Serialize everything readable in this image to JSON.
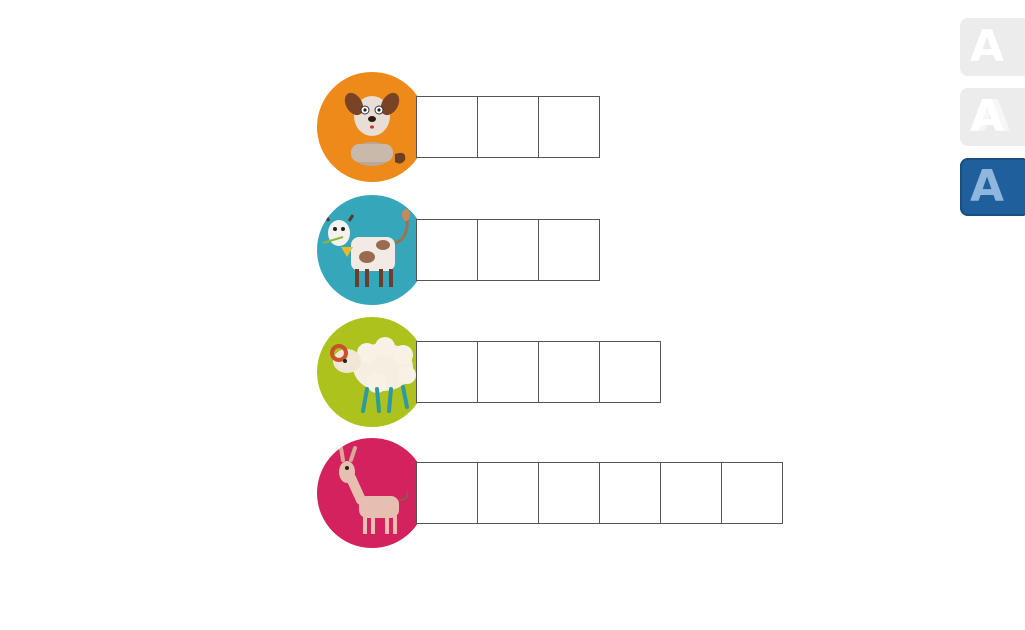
{
  "side_buttons": [
    {
      "letter": "A",
      "style": "plain"
    },
    {
      "letter": "A",
      "style": "outlined"
    },
    {
      "letter": "A",
      "style": "textured",
      "color": "#1f5f9b"
    }
  ],
  "rows": [
    {
      "animal": "dog",
      "circle_color": "#ee8a1a",
      "box_count": 3
    },
    {
      "animal": "cow",
      "circle_color": "#35a7bb",
      "box_count": 3
    },
    {
      "animal": "sheep",
      "circle_color": "#aec21d",
      "box_count": 4
    },
    {
      "animal": "donkey",
      "circle_color": "#d3225d",
      "box_count": 6
    }
  ]
}
